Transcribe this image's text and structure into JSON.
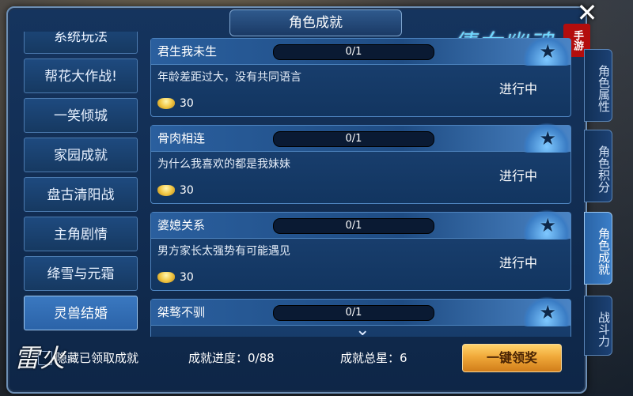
{
  "window": {
    "title": "角色成就",
    "close_glyph": "✕"
  },
  "logo": {
    "text": "倩女幽魂",
    "badge": "手游"
  },
  "left_list": {
    "items": [
      {
        "label": "系统玩法"
      },
      {
        "label": "帮花大作战!"
      },
      {
        "label": "一笑倾城"
      },
      {
        "label": "家园成就"
      },
      {
        "label": "盘古清阳战"
      },
      {
        "label": "主角剧情"
      },
      {
        "label": "绛雪与元霜"
      },
      {
        "label": "灵兽结婚",
        "selected": true
      }
    ]
  },
  "achievements": [
    {
      "name": "君生我未生",
      "progress": "0/1",
      "desc": "年龄差距过大，没有共同语言",
      "reward": "30",
      "status": "进行中"
    },
    {
      "name": "骨肉相连",
      "progress": "0/1",
      "desc": "为什么我喜欢的都是我妹妹",
      "reward": "30",
      "status": "进行中"
    },
    {
      "name": "婆媳关系",
      "progress": "0/1",
      "desc": "男方家长太强势有可能遇见",
      "reward": "30",
      "status": "进行中"
    },
    {
      "name": "桀骜不驯",
      "progress": "0/1",
      "desc": "",
      "reward": "",
      "status": ""
    }
  ],
  "footer": {
    "hide_claimed": "隐藏已领取成就",
    "progress_label": "成就进度：0/88",
    "stars_label": "成就总星：6",
    "claim_button": "一键领奖"
  },
  "side_tabs": [
    {
      "label": "角色属性"
    },
    {
      "label": "角色积分"
    },
    {
      "label": "角色成就",
      "active": true
    },
    {
      "label": "战斗力"
    }
  ],
  "watermark": "雷火",
  "icons": {
    "ingot": "gold-ingot-icon",
    "star": "star-icon",
    "scroll": "chevron-down-icon",
    "close": "close-icon"
  }
}
